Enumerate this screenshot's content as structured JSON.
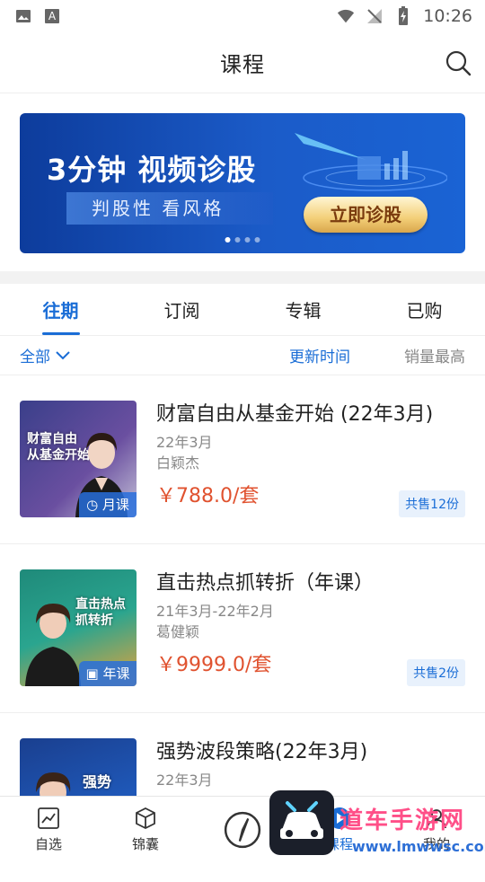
{
  "status_bar": {
    "time": "10:26",
    "icons": [
      "image-icon",
      "font-icon",
      "wifi-icon",
      "no-signal-icon",
      "battery-charging-icon"
    ]
  },
  "header": {
    "title": "课程",
    "search_icon": "search-icon"
  },
  "banner": {
    "headline": "3分钟 视频诊股",
    "subline": "判股性  看风格",
    "cta": "立即诊股",
    "page_count": 4,
    "active_page": 1
  },
  "tabs": [
    {
      "label": "往期",
      "active": true
    },
    {
      "label": "订阅",
      "active": false
    },
    {
      "label": "专辑",
      "active": false
    },
    {
      "label": "已购",
      "active": false
    }
  ],
  "filter": {
    "all_label": "全部",
    "sort_update": "更新时间",
    "sort_sales": "销量最高"
  },
  "courses": [
    {
      "title": "财富自由从基金开始 (22年3月)",
      "period": "22年3月",
      "teacher": "白颖杰",
      "price": "￥788.0/套",
      "sold": "共售12份",
      "badge": "月课",
      "thumb_caption": "财富自由\n从基金开始",
      "thumb_bg": "#4a4f9a"
    },
    {
      "title": "直击热点抓转折（年课）",
      "period": "21年3月-22年2月",
      "teacher": "葛健颖",
      "price": "￥9999.0/套",
      "sold": "共售2份",
      "badge": "年课",
      "thumb_caption": "直击热点\n抓转折",
      "thumb_bg": "#1f8a7a"
    },
    {
      "title": "强势波段策略(22年3月)",
      "period": "22年3月",
      "teacher": "",
      "price": "",
      "sold": "",
      "badge": "",
      "thumb_caption": "强势",
      "thumb_bg": "#1a3f8f"
    }
  ],
  "bottom_nav": [
    {
      "label": "自选",
      "icon": "chart-icon"
    },
    {
      "label": "锦囊",
      "icon": "cube-icon"
    },
    {
      "label": "",
      "icon": "compass-icon"
    },
    {
      "label": "课程",
      "icon": "play-icon"
    },
    {
      "label": "我的",
      "icon": "user-icon"
    }
  ],
  "watermark": {
    "text": "道车手游网",
    "url": "www.lmwwsc.com"
  },
  "colors": {
    "accent": "#1a6dd6",
    "price": "#e0522f",
    "banner_bg": "#1b5bc8"
  }
}
